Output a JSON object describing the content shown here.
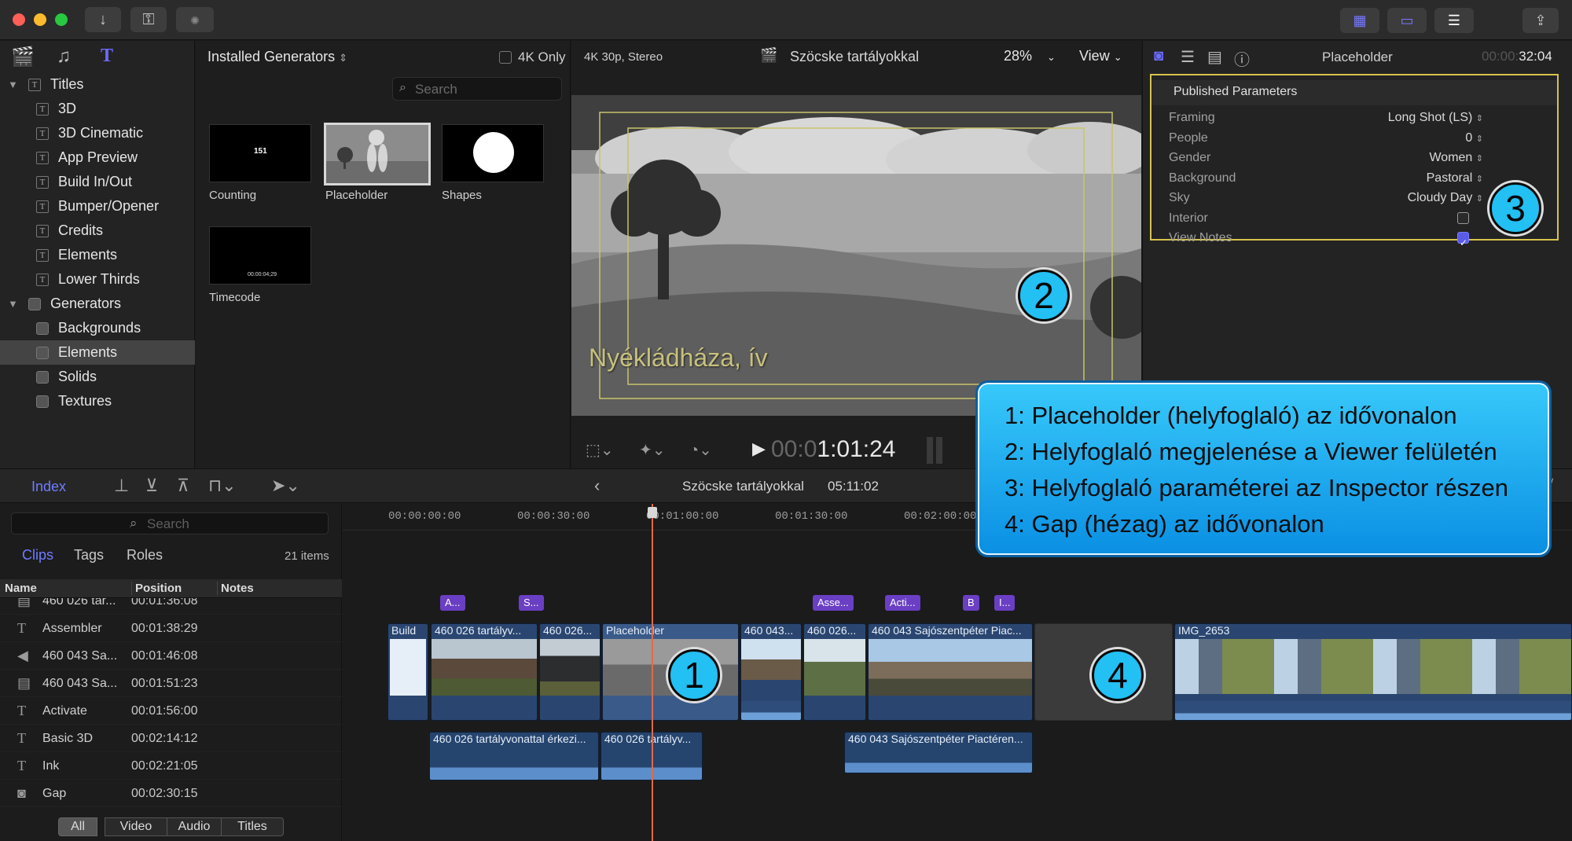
{
  "titlebar": {
    "buttons": [
      "download-icon",
      "key-icon",
      "progress-icon"
    ],
    "right_buttons": [
      "browser-layout-icon",
      "timeline-layout-icon",
      "inspector-layout-icon",
      "share-icon"
    ]
  },
  "browser": {
    "generators_menu": "Installed Generators",
    "fourk_only": "4K Only",
    "search_placeholder": "Search",
    "tree": [
      {
        "label": "Titles",
        "type": "group"
      },
      {
        "label": "3D",
        "type": "title"
      },
      {
        "label": "3D Cinematic",
        "type": "title"
      },
      {
        "label": "App Preview",
        "type": "title"
      },
      {
        "label": "Build In/Out",
        "type": "title"
      },
      {
        "label": "Bumper/Opener",
        "type": "title"
      },
      {
        "label": "Credits",
        "type": "title"
      },
      {
        "label": "Elements",
        "type": "title"
      },
      {
        "label": "Lower Thirds",
        "type": "title"
      },
      {
        "label": "Generators",
        "type": "group"
      },
      {
        "label": "Backgrounds",
        "type": "gen"
      },
      {
        "label": "Elements",
        "type": "gen"
      },
      {
        "label": "Solids",
        "type": "gen"
      },
      {
        "label": "Textures",
        "type": "gen"
      }
    ],
    "thumbs": [
      {
        "label": "Counting",
        "inner": "151"
      },
      {
        "label": "Placeholder",
        "inner": ""
      },
      {
        "label": "Shapes",
        "inner": ""
      },
      {
        "label": "Timecode",
        "inner": "00:00:04;29"
      }
    ]
  },
  "viewer": {
    "format": "4K 30p, Stereo",
    "project": "Szöcske tartályokkal",
    "zoom": "28%",
    "view_menu": "View",
    "overlay_text": "Nyékládháza, ív",
    "timecode_dim": "00:0",
    "timecode": "1:01:24"
  },
  "inspector": {
    "title": "Placeholder",
    "duration_dim": "00:00:",
    "duration": "32:04",
    "section": "Published Parameters",
    "params": [
      {
        "label": "Framing",
        "value": "Long Shot (LS)"
      },
      {
        "label": "People",
        "value": "0"
      },
      {
        "label": "Gender",
        "value": "Women"
      },
      {
        "label": "Background",
        "value": "Pastoral"
      },
      {
        "label": "Sky",
        "value": "Cloudy Day"
      },
      {
        "label": "Interior",
        "value": "",
        "checkbox": false
      },
      {
        "label": "View Notes",
        "value": "",
        "checkbox": true
      }
    ]
  },
  "callout": {
    "lines": [
      "1: Placeholder (helyfoglaló) az idővonalon",
      "2: Helyfoglaló megjelenése a Viewer felületén",
      "3: Helyfoglaló paraméterei az Inspector részen",
      "4: Gap (hézag) az idővonalon"
    ],
    "badges": [
      "1",
      "2",
      "3",
      "4"
    ]
  },
  "timeline_toolbar": {
    "index_label": "Index",
    "project": "Szöcske tartályokkal",
    "duration": "05:11:02"
  },
  "index": {
    "search_placeholder": "Search",
    "tabs": [
      "Clips",
      "Tags",
      "Roles"
    ],
    "count": "21 items",
    "columns": [
      "Name",
      "Position",
      "Notes"
    ],
    "rows": [
      {
        "icon": "film",
        "name": "460 026 tar...",
        "pos": "00:01:36:08"
      },
      {
        "icon": "T",
        "name": "Assembler",
        "pos": "00:01:38:29"
      },
      {
        "icon": "audio",
        "name": "460 043 Sa...",
        "pos": "00:01:46:08"
      },
      {
        "icon": "film",
        "name": "460 043 Sa...",
        "pos": "00:01:51:23"
      },
      {
        "icon": "T",
        "name": "Activate",
        "pos": "00:01:56:00"
      },
      {
        "icon": "T",
        "name": "Basic 3D",
        "pos": "00:02:14:12"
      },
      {
        "icon": "T",
        "name": "Ink",
        "pos": "00:02:21:05"
      },
      {
        "icon": "gen",
        "name": "Gap",
        "pos": "00:02:30:15"
      }
    ],
    "filters": [
      "All",
      "Video",
      "Audio",
      "Titles"
    ]
  },
  "timeline": {
    "ruler": [
      "00:00:00:00",
      "00:00:30:00",
      "00:01:00:00",
      "00:01:30:00",
      "00:02:00:00"
    ],
    "markers": [
      "A...",
      "S...",
      "Asse...",
      "Acti...",
      "B",
      "I..."
    ],
    "clips": [
      {
        "title": "Build"
      },
      {
        "title": "460 026 tartályv..."
      },
      {
        "title": "460 026..."
      },
      {
        "title": "Placeholder"
      },
      {
        "title": "460 043..."
      },
      {
        "title": "460 026..."
      },
      {
        "title": "460 043 Sajószentpéter Piac..."
      },
      {
        "title": ""
      },
      {
        "title": "IMG_2653"
      }
    ],
    "audio_clips": [
      {
        "title": "460 026 tartályvonattal érkezi..."
      },
      {
        "title": "460 026 tartályv..."
      },
      {
        "title": "460 043 Sajószentpéter Piactéren..."
      }
    ]
  },
  "colors": {
    "accent": "#5b6cf2",
    "callout": "#22b8f3",
    "clip": "#2a4670",
    "playhead": "#e06a4a"
  }
}
